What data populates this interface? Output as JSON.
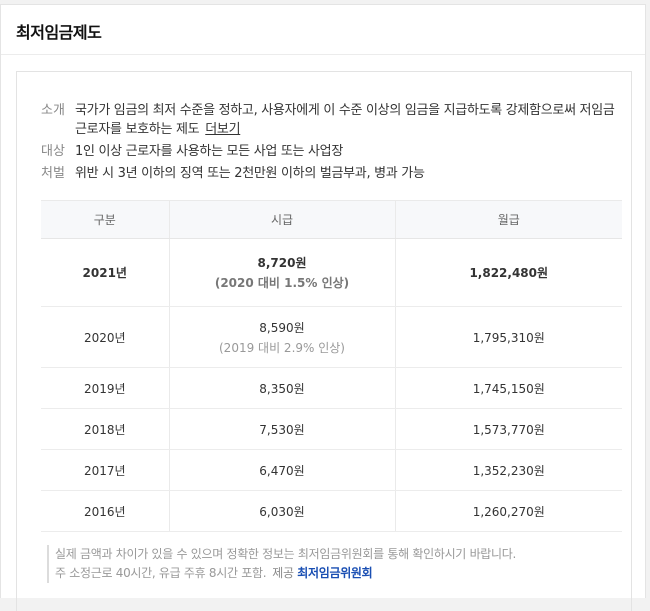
{
  "title": "최저임금제도",
  "info": {
    "intro_label": "소개",
    "intro_text": "국가가 임금의 최저 수준을 정하고, 사용자에게 이 수준 이상의 임금을 지급하도록 강제함으로써 저임금 근로자를 보호하는 제도",
    "more_link": "더보기",
    "target_label": "대상",
    "target_text": "1인 이상 근로자를 사용하는 모든 사업 또는 사업장",
    "penalty_label": "처벌",
    "penalty_text": "위반 시 3년 이하의 징역 또는 2천만원 이하의 벌금부과, 병과 가능"
  },
  "table": {
    "headers": [
      "구분",
      "시급",
      "월급"
    ],
    "rows": [
      {
        "year": "2021년",
        "hourly": "8,720원",
        "hourly_note": "(2020 대비 1.5% 인상)",
        "monthly": "1,822,480원"
      },
      {
        "year": "2020년",
        "hourly": "8,590원",
        "hourly_note": "(2019 대비 2.9% 인상)",
        "monthly": "1,795,310원"
      },
      {
        "year": "2019년",
        "hourly": "8,350원",
        "monthly": "1,745,150원"
      },
      {
        "year": "2018년",
        "hourly": "7,530원",
        "monthly": "1,573,770원"
      },
      {
        "year": "2017년",
        "hourly": "6,470원",
        "monthly": "1,352,230원"
      },
      {
        "year": "2016년",
        "hourly": "6,030원",
        "monthly": "1,260,270원"
      }
    ]
  },
  "note": {
    "disclaimer": "실제 금액과 차이가 있을 수 있으며 정확한 정보는 최저임금위원회를 통해 확인하시기 바랍니다.",
    "basis": "주 소정근로 40시간, 유급 주휴 8시간 포함.",
    "provider_label": "제공",
    "provider_link": "최저임금위원회"
  },
  "colors": {
    "provider_link": "#1a4fb3",
    "header_bg": "#f7f8fa"
  }
}
